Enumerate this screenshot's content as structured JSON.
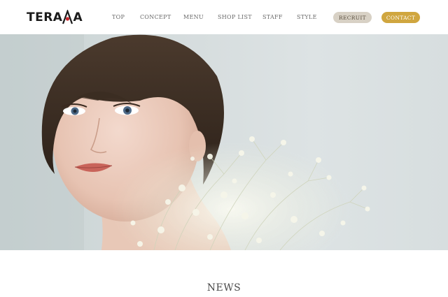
{
  "header": {
    "logo_text_left": "TERA",
    "logo_text_right": "A",
    "nav": [
      {
        "label": "TOP"
      },
      {
        "label": "CONCEPT"
      },
      {
        "label": "MENU"
      },
      {
        "label": "SHOP LIST"
      },
      {
        "label": "STAFF"
      },
      {
        "label": "STYLE"
      }
    ],
    "recruit_label": "RECRUIT",
    "contact_label": "CONTACT"
  },
  "colors": {
    "contact_bg": "#d0a63f",
    "recruit_bg": "#d8d1c5",
    "logo_accent": "#c8262c"
  },
  "news": {
    "title": "NEWS"
  }
}
